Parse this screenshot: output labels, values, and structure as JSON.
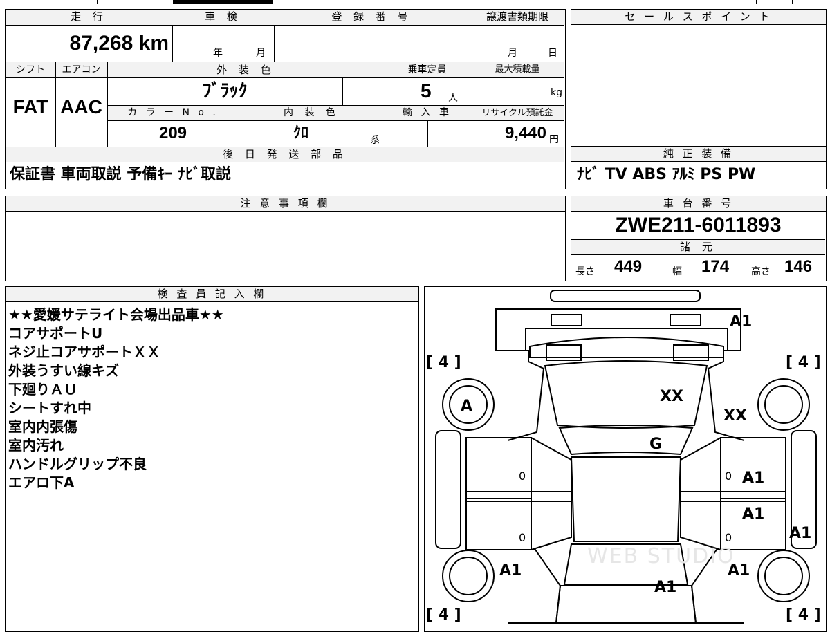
{
  "mileage": {
    "label": "走 行",
    "value": "87,268 km"
  },
  "inspection": {
    "label": "車 検",
    "year_label": "年",
    "month_label": "月"
  },
  "registration": {
    "label": "登 録 番 号",
    "value": ""
  },
  "transfer_deadline": {
    "label": "譲渡書類期限",
    "month_label": "月",
    "day_label": "日"
  },
  "sales_point": {
    "label": "セ ー ル ス ポ イ ン ト",
    "value": ""
  },
  "shift": {
    "label": "シフト",
    "value": "FAT"
  },
  "aircon": {
    "label": "エアコン",
    "value": "AAC"
  },
  "exterior_color": {
    "label": "外 装 色",
    "value": "ﾌﾞﾗｯｸ"
  },
  "capacity": {
    "label": "乗車定員",
    "value": "5",
    "unit": "人"
  },
  "max_load": {
    "label": "最大積載量",
    "unit": "kg"
  },
  "color_no": {
    "label": "カ ラ ー N o .",
    "value": "209"
  },
  "interior_color": {
    "label": "内 装 色",
    "value": "ｸﾛ",
    "suffix": "系"
  },
  "import": {
    "label": "輸 入 車"
  },
  "recycle": {
    "label": "リサイクル預託金",
    "value": "9,440",
    "unit": "円"
  },
  "later_parts": {
    "label": "後 日 発 送 部 品",
    "value": "保証書 車両取説 予備ｷｰ ﾅﾋﾞ取説"
  },
  "genuine_equipment": {
    "label": "純 正 装 備",
    "value": "ﾅﾋﾞ TV ABS ｱﾙﾐ PS PW"
  },
  "caution": {
    "label": "注 意 事 項 欄",
    "value": ""
  },
  "chassis": {
    "label": "車 台 番 号",
    "value": "ZWE211-6011893"
  },
  "specs": {
    "label": "諸 元",
    "length_label": "長さ",
    "length": "449",
    "width_label": "幅",
    "width": "174",
    "height_label": "高さ",
    "height": "146"
  },
  "inspector": {
    "label": "検 査 員 記 入 欄",
    "notes": [
      "★★愛媛サテライト会場出品車★★",
      "コアサポートU",
      "ネジ止コアサポートＸＸ",
      "外装うすい線キズ",
      "下廻りＡＵ",
      "シートすれ中",
      "室内内張傷",
      "室内汚れ",
      "ハンドルグリップ不良",
      "エアロ下A"
    ]
  },
  "diagram": {
    "tire_tl": "[ 4 ]",
    "tire_tr": "[ 4 ]",
    "tire_bl": "[ 4 ]",
    "tire_br": "[ 4 ]",
    "front_bumper": "A1",
    "hood": "XX",
    "right_fender": "XX",
    "left_fender": "A",
    "roof": "G",
    "left_front_door": "0",
    "left_rear_door": "0",
    "right_front_door_zero": "0",
    "right_front_door": "A1",
    "right_rear_door": "A1",
    "right_rear_door_zero": "0",
    "right_rocker": "A1",
    "left_quarter": "A1",
    "right_quarter": "A1",
    "trunk": "A1",
    "watermark": "WEB STUDIO"
  }
}
